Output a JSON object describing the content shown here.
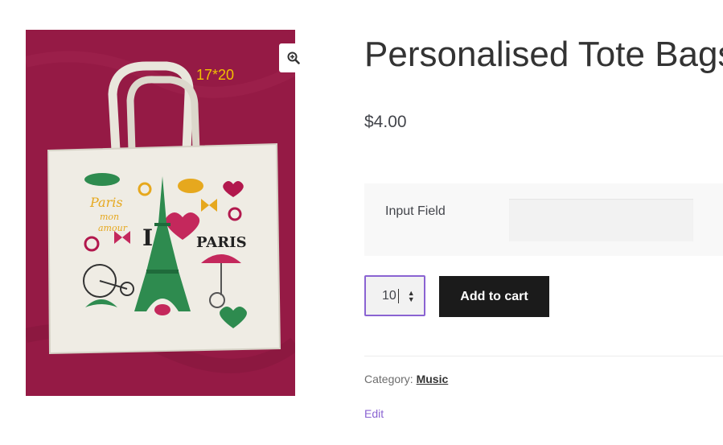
{
  "product": {
    "title": "Personalised Tote Bags",
    "price": "$4.00",
    "image_size_label": "17*20",
    "image_print_text": "PARIS",
    "image_print_letter": "I"
  },
  "addon": {
    "label": "Input Field",
    "value": ""
  },
  "quantity": {
    "value": "10"
  },
  "cart": {
    "button_label": "Add to cart"
  },
  "meta": {
    "category_label": "Category:",
    "category_value": "Music"
  },
  "admin": {
    "edit_label": "Edit"
  },
  "icons": {
    "zoom": "magnifier-plus-icon",
    "spinner": "spinner-arrows-icon"
  },
  "colors": {
    "image_background": "#951a45",
    "focus_border": "#8a63d2",
    "button_background": "#1b1b1b",
    "edit_link": "#8a63d2"
  }
}
